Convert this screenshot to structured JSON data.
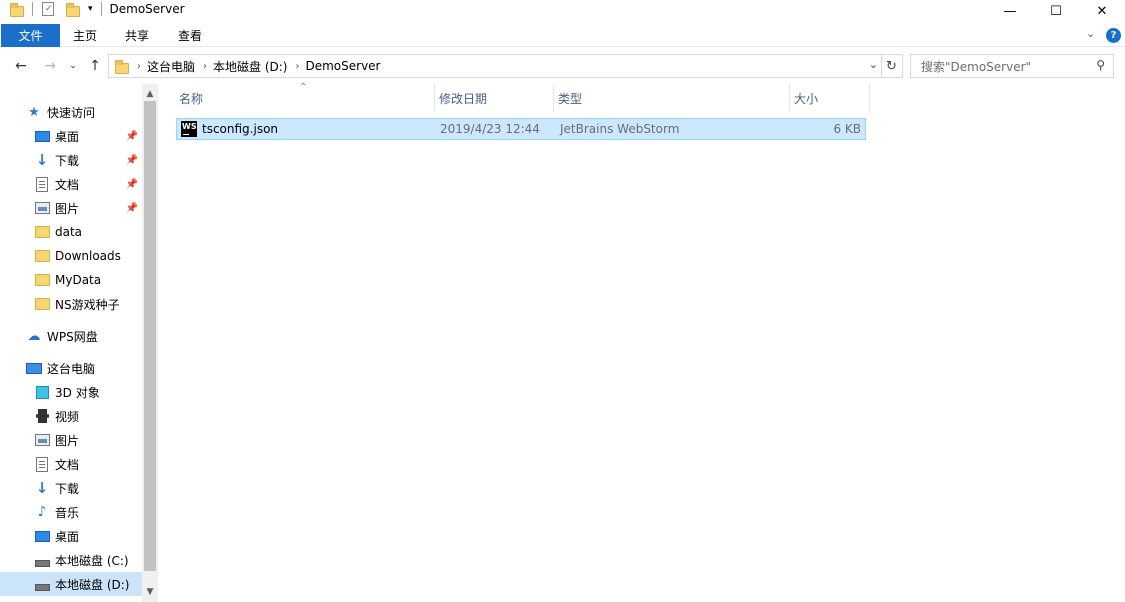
{
  "window": {
    "title": "DemoServer",
    "minimize": "—",
    "maximize": "☐",
    "close": "✕"
  },
  "ribbon": {
    "tabs": [
      "文件",
      "主页",
      "共享",
      "查看"
    ],
    "expand_icon": "chevron-down-icon",
    "help_icon": "help-icon"
  },
  "address": {
    "crumbs": [
      "这台电脑",
      "本地磁盘 (D:)",
      "DemoServer"
    ]
  },
  "search": {
    "placeholder": "搜索\"DemoServer\""
  },
  "nav": {
    "quick_access": "快速访问",
    "quick_items": [
      {
        "label": "桌面",
        "icon": "desktop-icon",
        "pinned": true
      },
      {
        "label": "下载",
        "icon": "download-icon",
        "pinned": true
      },
      {
        "label": "文档",
        "icon": "document-icon",
        "pinned": true
      },
      {
        "label": "图片",
        "icon": "picture-icon",
        "pinned": true
      },
      {
        "label": "data",
        "icon": "folder-icon",
        "pinned": false
      },
      {
        "label": "Downloads",
        "icon": "folder-icon",
        "pinned": false
      },
      {
        "label": "MyData",
        "icon": "folder-icon",
        "pinned": false
      },
      {
        "label": "NS游戏种子",
        "icon": "folder-icon",
        "pinned": false
      }
    ],
    "wps": "WPS网盘",
    "this_pc": "这台电脑",
    "pc_items": [
      {
        "label": "3D 对象",
        "icon": "3d-objects-icon"
      },
      {
        "label": "视频",
        "icon": "video-icon"
      },
      {
        "label": "图片",
        "icon": "picture-icon"
      },
      {
        "label": "文档",
        "icon": "document-icon"
      },
      {
        "label": "下载",
        "icon": "download-icon"
      },
      {
        "label": "音乐",
        "icon": "music-icon"
      },
      {
        "label": "桌面",
        "icon": "desktop-icon"
      },
      {
        "label": "本地磁盘 (C:)",
        "icon": "drive-icon"
      },
      {
        "label": "本地磁盘 (D:)",
        "icon": "drive-icon"
      }
    ]
  },
  "columns": {
    "name": "名称",
    "modified": "修改日期",
    "type": "类型",
    "size": "大小"
  },
  "files": [
    {
      "name": "tsconfig.json",
      "modified": "2019/4/23 12:44",
      "type": "JetBrains WebStorm",
      "size": "6 KB",
      "icon": "webstorm-icon"
    }
  ]
}
